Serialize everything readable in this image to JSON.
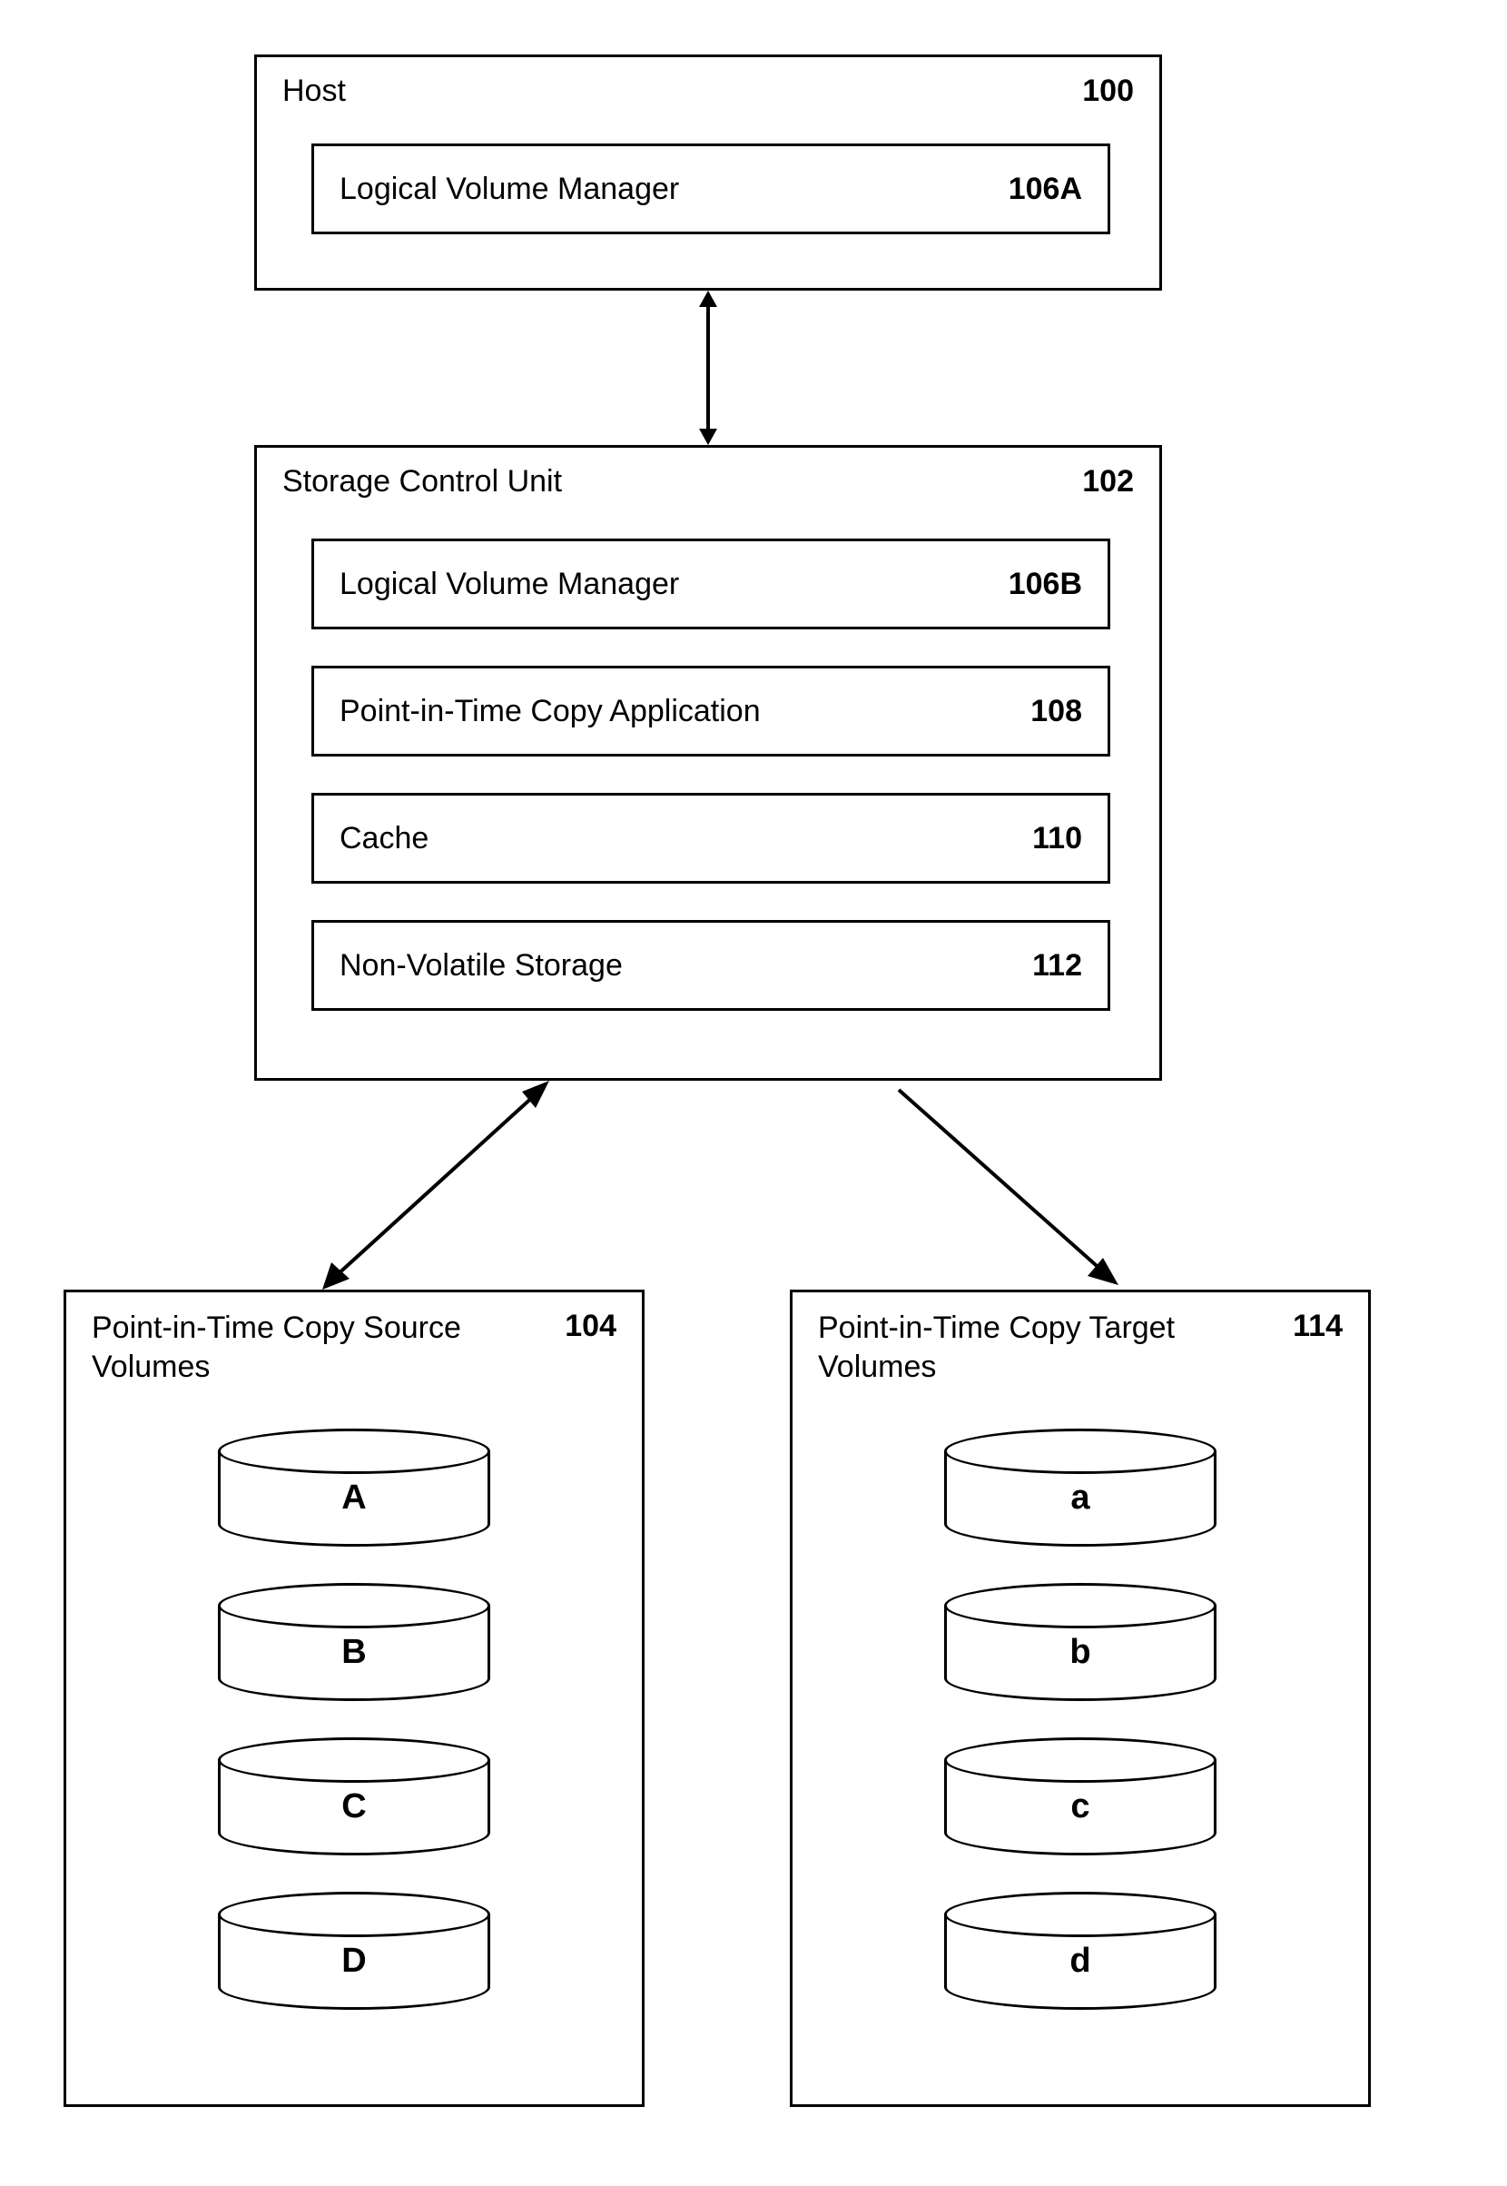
{
  "host": {
    "title": "Host",
    "num": "100",
    "lvm": {
      "label": "Logical Volume Manager",
      "num": "106A"
    }
  },
  "scu": {
    "title": "Storage Control Unit",
    "num": "102",
    "lvm": {
      "label": "Logical Volume Manager",
      "num": "106B"
    },
    "pit": {
      "label": "Point-in-Time Copy Application",
      "num": "108"
    },
    "cache": {
      "label": "Cache",
      "num": "110"
    },
    "nvs": {
      "label": "Non-Volatile Storage",
      "num": "112"
    }
  },
  "source": {
    "title": "Point-in-Time Copy Source Volumes",
    "num": "104",
    "vols": [
      "A",
      "B",
      "C",
      "D"
    ]
  },
  "target": {
    "title": "Point-in-Time Copy Target Volumes",
    "num": "114",
    "vols": [
      "a",
      "b",
      "c",
      "d"
    ]
  }
}
